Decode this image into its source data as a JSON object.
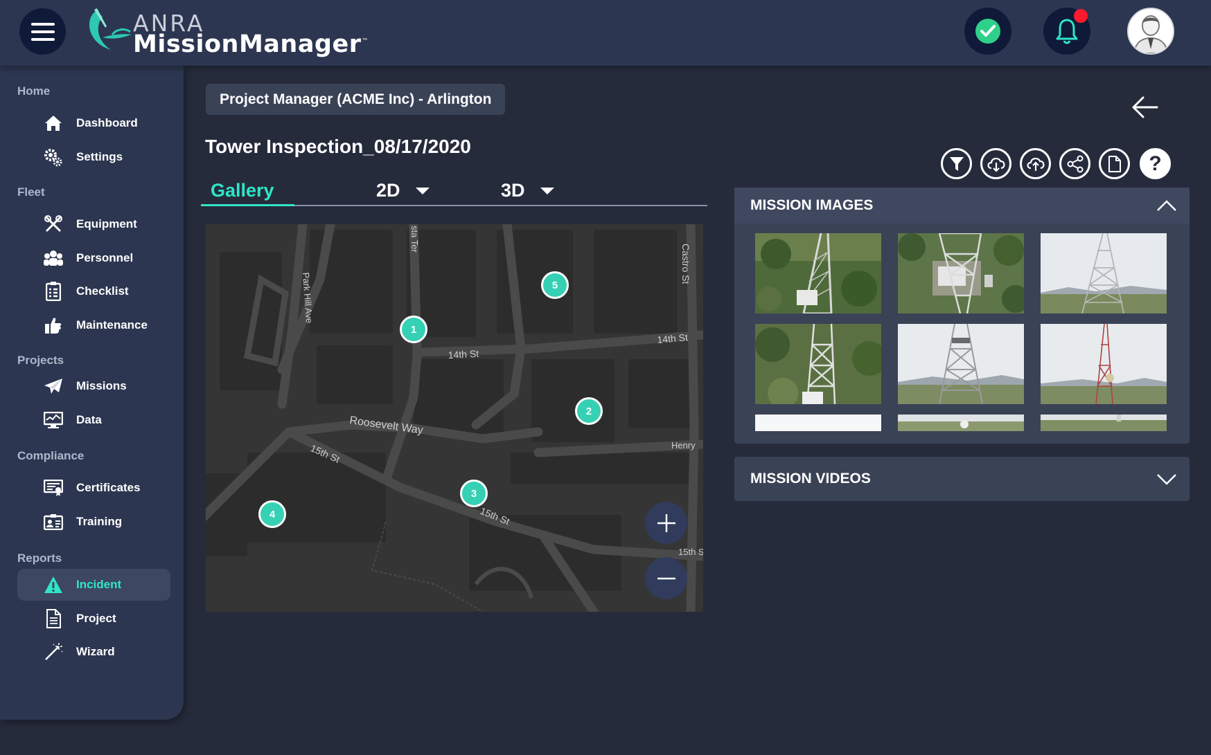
{
  "app": {
    "logo_top": "ANRA",
    "logo_bottom": "MissionManager",
    "logo_tm": "™",
    "accent_color": "#2ee6c6",
    "notification_dot_color": "#ff1a2e"
  },
  "header_icons": {
    "menu": "hamburger-icon",
    "status": "check-circle-icon",
    "notifications": "bell-icon",
    "profile": "user-avatar"
  },
  "sidebar": {
    "sections": [
      {
        "title": "Home",
        "items": [
          {
            "label": "Dashboard",
            "icon": "home-icon"
          },
          {
            "label": "Settings",
            "icon": "gears-icon"
          }
        ]
      },
      {
        "title": "Fleet",
        "items": [
          {
            "label": "Equipment",
            "icon": "tools-icon"
          },
          {
            "label": "Personnel",
            "icon": "people-icon"
          },
          {
            "label": "Checklist",
            "icon": "checklist-icon"
          },
          {
            "label": "Maintenance",
            "icon": "maintenance-icon"
          }
        ]
      },
      {
        "title": "Projects",
        "items": [
          {
            "label": "Missions",
            "icon": "paper-plane-icon"
          },
          {
            "label": "Data",
            "icon": "monitor-icon"
          }
        ]
      },
      {
        "title": "Compliance",
        "items": [
          {
            "label": "Certificates",
            "icon": "certificate-icon"
          },
          {
            "label": "Training",
            "icon": "id-card-icon"
          }
        ]
      },
      {
        "title": "Reports",
        "items": [
          {
            "label": "Incident",
            "icon": "warning-icon",
            "active": true
          },
          {
            "label": "Project",
            "icon": "document-icon"
          },
          {
            "label": "Wizard",
            "icon": "wand-icon"
          }
        ]
      }
    ]
  },
  "main": {
    "breadcrumb": "Project Manager (ACME Inc) - Arlington",
    "title": "Tower Inspection_08/17/2020",
    "tabs": [
      {
        "label": "Gallery",
        "active": true
      },
      {
        "label": "2D",
        "dropdown": true
      },
      {
        "label": "3D",
        "dropdown": true
      }
    ],
    "toolbar": [
      "filter-icon",
      "download-icon",
      "upload-icon",
      "share-icon",
      "document-icon",
      "help-icon"
    ],
    "help_label": "?"
  },
  "map": {
    "street_labels": [
      "14th St",
      "14th St",
      "Roosevelt Way",
      "15th St",
      "15th St",
      "15th S",
      "Park Hill Ave",
      "Castro St",
      "Henry",
      "sta Ter"
    ],
    "markers": [
      "1",
      "2",
      "3",
      "4",
      "5"
    ],
    "zoom_in": "+",
    "zoom_out": "−"
  },
  "panels": {
    "images_title": "MISSION IMAGES",
    "videos_title": "MISSION VIDEOS",
    "image_count_visible": 9
  }
}
